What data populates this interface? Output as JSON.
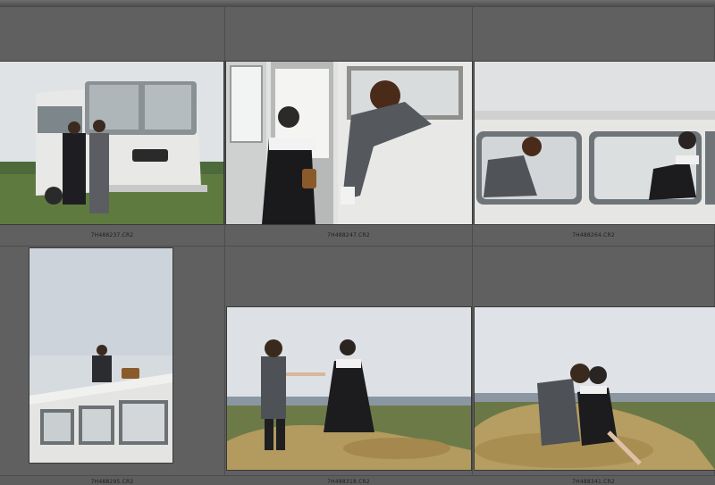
{
  "grid": {
    "thumbnails": [
      {
        "filename": "7H488237.CR2"
      },
      {
        "filename": "7H488247.CR2"
      },
      {
        "filename": "7H488264.CR2"
      },
      {
        "filename": "7H488295.CR2"
      },
      {
        "filename": "7H488318.CR2"
      },
      {
        "filename": "7H488341.CR2"
      }
    ]
  }
}
